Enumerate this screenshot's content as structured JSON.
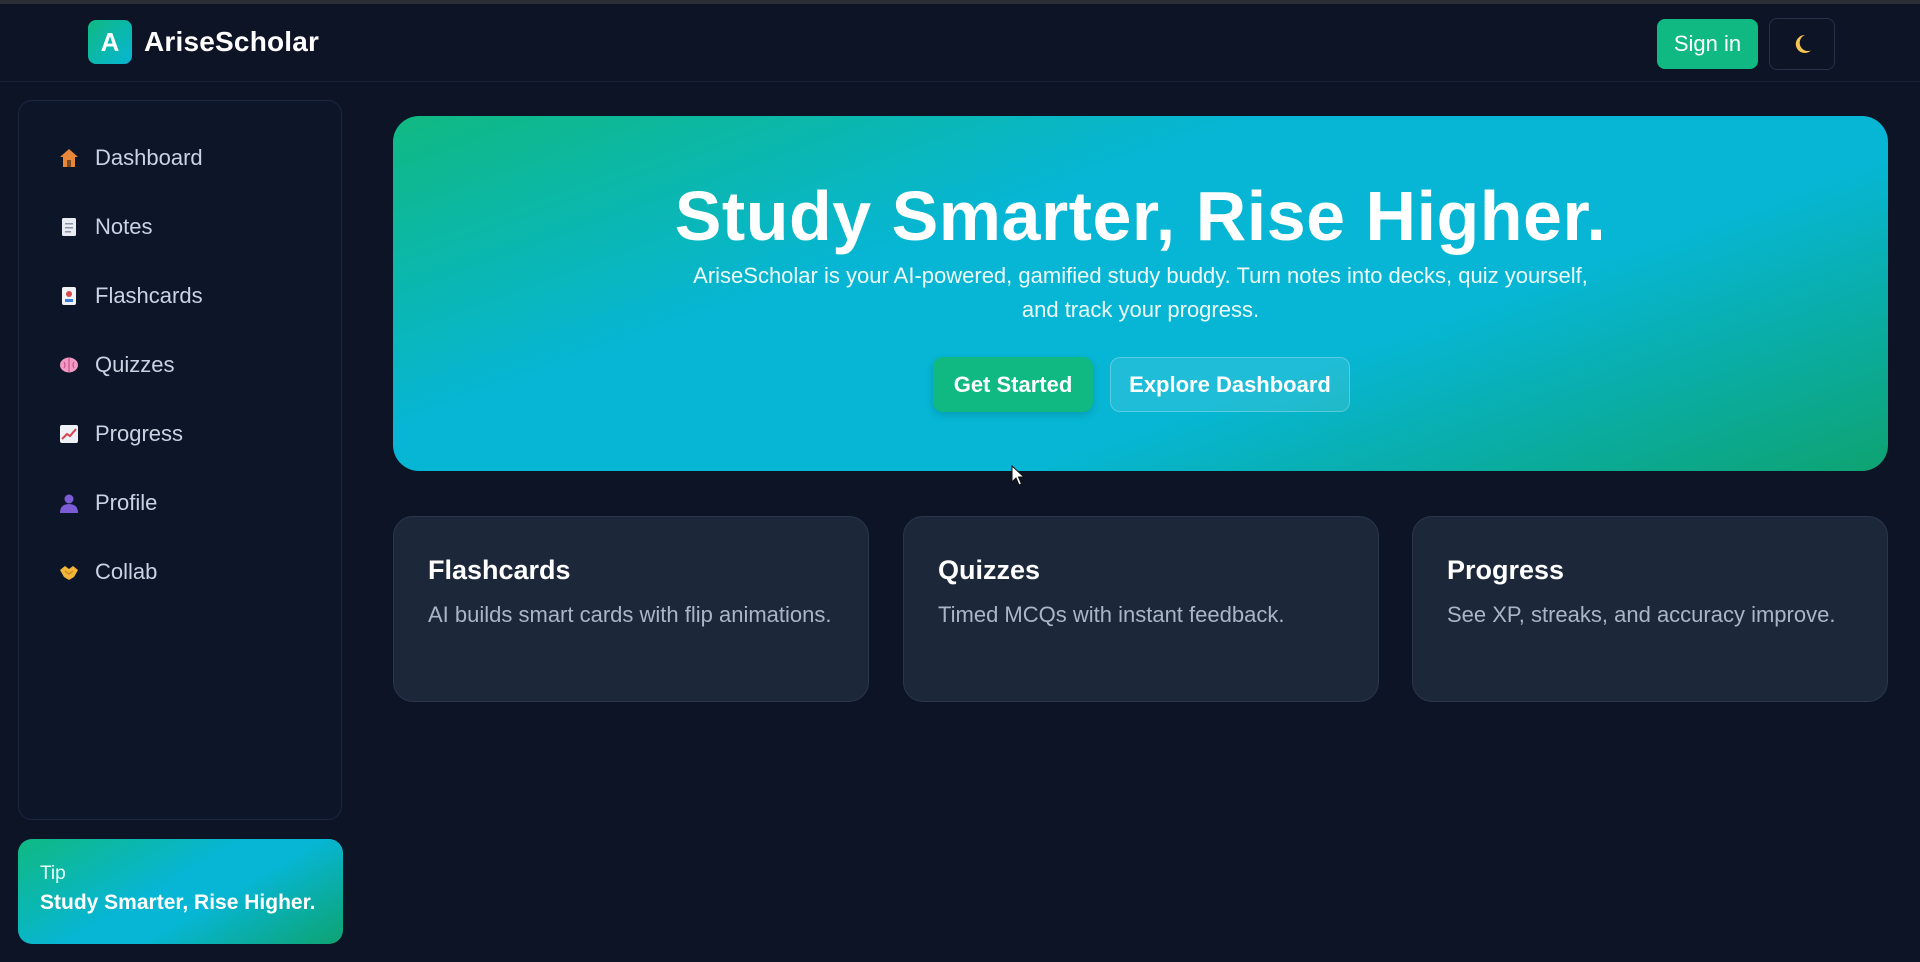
{
  "header": {
    "logo_letter": "A",
    "brand": "AriseScholar",
    "signin_label": "Sign in",
    "theme_icon": "moon-icon"
  },
  "sidebar": {
    "items": [
      {
        "label": "Dashboard",
        "icon": "house-icon"
      },
      {
        "label": "Notes",
        "icon": "document-icon"
      },
      {
        "label": "Flashcards",
        "icon": "cards-icon"
      },
      {
        "label": "Quizzes",
        "icon": "brain-icon"
      },
      {
        "label": "Progress",
        "icon": "chart-icon"
      },
      {
        "label": "Profile",
        "icon": "user-icon"
      },
      {
        "label": "Collab",
        "icon": "handshake-icon"
      }
    ],
    "tip": {
      "label": "Tip",
      "text": "Study Smarter, Rise Higher."
    }
  },
  "hero": {
    "title": "Study Smarter, Rise Higher.",
    "subtitle": "AriseScholar is your AI-powered, gamified study buddy. Turn notes into decks, quiz yourself, and track your progress.",
    "primary_label": "Get Started",
    "secondary_label": "Explore Dashboard"
  },
  "features": [
    {
      "title": "Flashcards",
      "text": "AI builds smart cards with flip animations."
    },
    {
      "title": "Quizzes",
      "text": "Timed MCQs with instant feedback."
    },
    {
      "title": "Progress",
      "text": "See XP, streaks, and accuracy improve."
    }
  ],
  "colors": {
    "background": "#0c1426",
    "accent": "#10b981",
    "accent_2": "#06b6d4",
    "card": "#1c273a"
  }
}
